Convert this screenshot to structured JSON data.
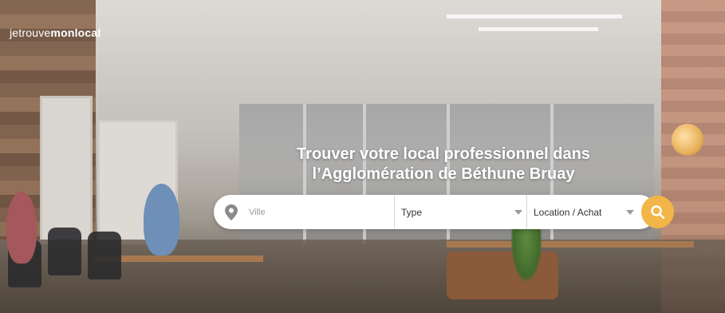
{
  "brand": {
    "prefix": "jetrouve",
    "bold": "monlocal"
  },
  "hero": {
    "title_line1": "Trouver votre local professionnel dans",
    "title_line2": "l’Agglomération de Béthune Bruay"
  },
  "search": {
    "city_placeholder": "Ville",
    "type_label": "Type",
    "transaction_label": "Location / Achat"
  },
  "colors": {
    "accent": "#f2b548",
    "pin": "#8a8a8a"
  },
  "icons": {
    "city": "location-pin-icon",
    "submit": "search-icon"
  }
}
